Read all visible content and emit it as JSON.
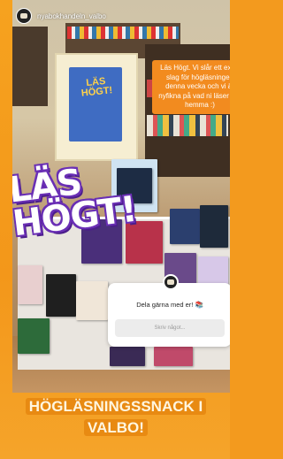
{
  "header": {
    "username": "nyabokhandeln_valbo",
    "avatar_icon": "store-logo-icon"
  },
  "poster": {
    "title": "LÄS HÖGT!"
  },
  "display_sign": {
    "text": "LÄS HÖGT!"
  },
  "sticker": {
    "text": "Läs Högt. Vi slår ett extra slag för högläsningen denna vecka och vi är nyfikna på vad ni läser där hemma :)"
  },
  "question_sticker": {
    "prompt": "Dela gärna med er! 📚",
    "placeholder": "Skriv något..."
  },
  "caption": {
    "text": "HÖGLÄSNINGSSNACK I VALBO!"
  },
  "colors": {
    "story_background": "#f39a1e",
    "sticker_background": "#f28b1f",
    "caption_highlight": "#e88a12",
    "sign_purple": "#6a2fb5"
  }
}
